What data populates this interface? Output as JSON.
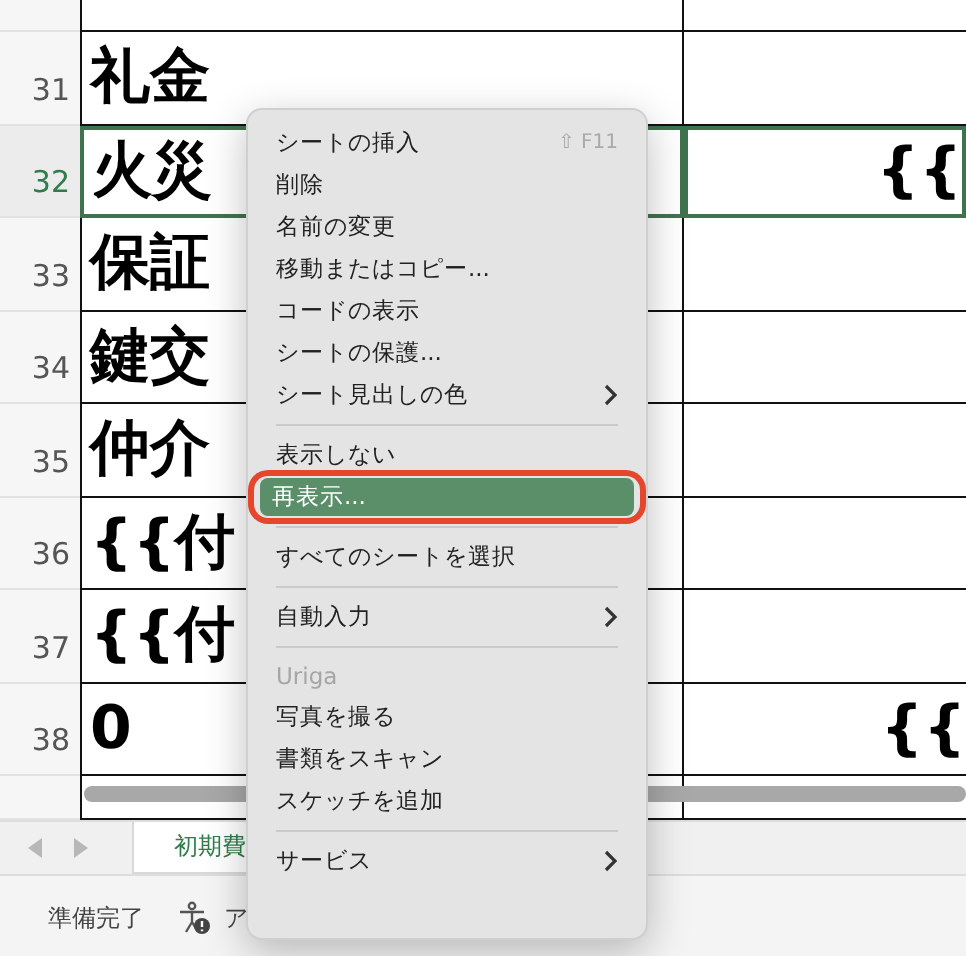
{
  "sheet": {
    "rows": [
      {
        "number": "",
        "cell_a": "",
        "cell_b": ""
      },
      {
        "number": "31",
        "cell_a": "礼金",
        "cell_b": "",
        "selected": false
      },
      {
        "number": "32",
        "cell_a": "火災",
        "cell_b": "{{",
        "selected": true
      },
      {
        "number": "33",
        "cell_a": "保証",
        "cell_b": "",
        "selected": false
      },
      {
        "number": "34",
        "cell_a": "鍵交",
        "cell_b": "",
        "selected": false
      },
      {
        "number": "35",
        "cell_a": "仲介",
        "cell_b": "",
        "selected": false
      },
      {
        "number": "36",
        "cell_a": "{{付",
        "cell_b": "",
        "selected": false
      },
      {
        "number": "37",
        "cell_a": "{{付",
        "cell_b": "",
        "selected": false
      },
      {
        "number": "38",
        "cell_a": "0",
        "cell_b": "{{",
        "selected": false
      },
      {
        "number": "",
        "cell_a": "",
        "cell_b": ""
      }
    ]
  },
  "sheet_tabs": [
    {
      "label": "初期費",
      "selected": true
    }
  ],
  "status_bar": {
    "status": "準備完了",
    "accessibility": "ア"
  },
  "context_menu": {
    "items": [
      {
        "kind": "item",
        "label": "シートの挿入",
        "shortcut": "⇧ F11",
        "submenu": false,
        "selected": false
      },
      {
        "kind": "item",
        "label": "削除",
        "submenu": false,
        "selected": false
      },
      {
        "kind": "item",
        "label": "名前の変更",
        "submenu": false,
        "selected": false
      },
      {
        "kind": "item",
        "label": "移動またはコピー...",
        "submenu": false,
        "selected": false
      },
      {
        "kind": "item",
        "label": "コードの表示",
        "submenu": false,
        "selected": false
      },
      {
        "kind": "item",
        "label": "シートの保護...",
        "submenu": false,
        "selected": false
      },
      {
        "kind": "item",
        "label": "シート見出しの色",
        "submenu": true,
        "selected": false
      },
      {
        "kind": "separator"
      },
      {
        "kind": "item",
        "label": "表示しない",
        "submenu": false,
        "selected": false
      },
      {
        "kind": "item",
        "label": "再表示...",
        "submenu": false,
        "selected": true,
        "circled": true
      },
      {
        "kind": "separator"
      },
      {
        "kind": "item",
        "label": "すべてのシートを選択",
        "submenu": false,
        "selected": false
      },
      {
        "kind": "separator"
      },
      {
        "kind": "item",
        "label": "自動入力",
        "submenu": true,
        "selected": false
      },
      {
        "kind": "separator"
      },
      {
        "kind": "header",
        "label": "Uriga"
      },
      {
        "kind": "item",
        "label": "写真を撮る",
        "submenu": false,
        "selected": false
      },
      {
        "kind": "item",
        "label": "書類をスキャン",
        "submenu": false,
        "selected": false
      },
      {
        "kind": "item",
        "label": "スケッチを追加",
        "submenu": false,
        "selected": false
      },
      {
        "kind": "separator"
      },
      {
        "kind": "item",
        "label": "サービス",
        "submenu": true,
        "selected": false
      }
    ]
  }
}
